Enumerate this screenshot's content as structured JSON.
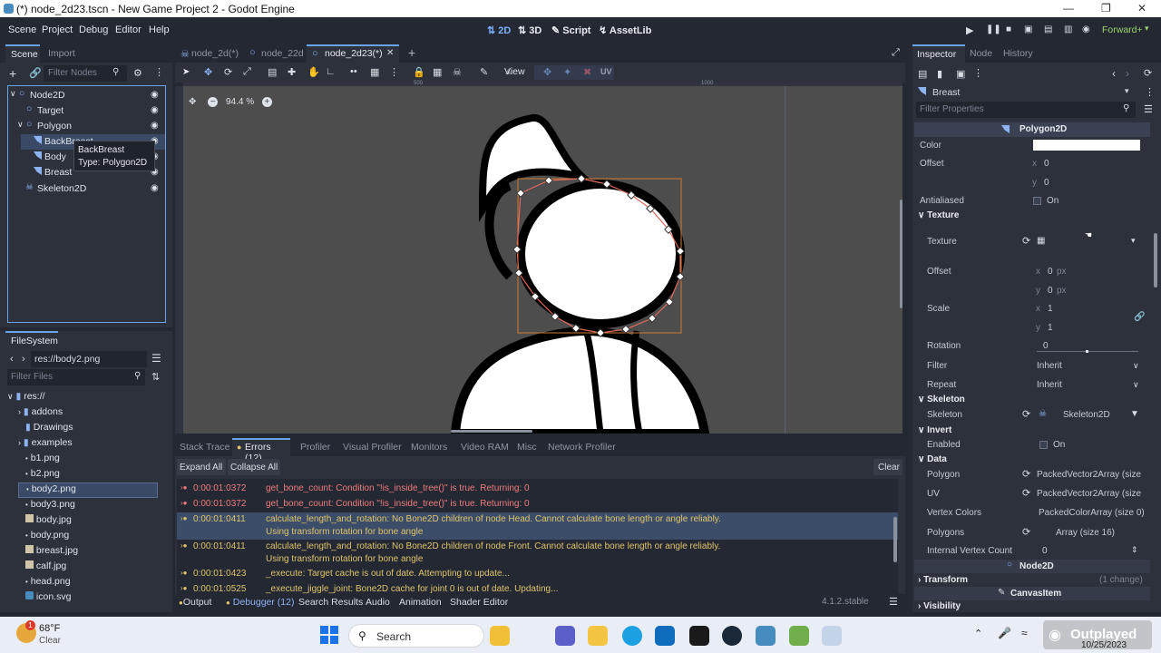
{
  "window": {
    "title": "(*) node_2d23.tscn - New Game Project 2 - Godot Engine"
  },
  "menu": {
    "items": [
      "Scene",
      "Project",
      "Debug",
      "Editor",
      "Help"
    ]
  },
  "workspaces": [
    "2D",
    "3D",
    "Script",
    "AssetLib"
  ],
  "renderer": "Forward+",
  "scene_dock": {
    "tabs": [
      "Scene",
      "Import"
    ],
    "filter_placeholder": "Filter Nodes",
    "tree": [
      {
        "label": "Node2D",
        "depth": 0
      },
      {
        "label": "Target",
        "depth": 1
      },
      {
        "label": "Polygon",
        "depth": 1
      },
      {
        "label": "BackBreast",
        "depth": 2
      },
      {
        "label": "Body",
        "depth": 2
      },
      {
        "label": "Breast",
        "depth": 2
      },
      {
        "label": "Skeleton2D",
        "depth": 1
      }
    ],
    "tooltip_line1": "BackBreast",
    "tooltip_line2": "Type: Polygon2D"
  },
  "filesystem": {
    "title": "FileSystem",
    "path": "res://body2.png",
    "filter_placeholder": "Filter Files",
    "items": [
      "res://",
      "addons",
      "Drawings",
      "examples",
      "b1.png",
      "b2.png",
      "body2.png",
      "body3.png",
      "body.jpg",
      "body.png",
      "breast.jpg",
      "calf.jpg",
      "head.png",
      "icon.svg"
    ]
  },
  "editor_tabs": [
    "node_2d(*)",
    "node_22d",
    "node_2d23(*)"
  ],
  "toolbar": {
    "view_label": "View",
    "uv_label": "UV"
  },
  "viewport": {
    "zoom": "94.4 %",
    "ruler_500": "500",
    "ruler_1000": "1000"
  },
  "bottom_panel": {
    "tabs": [
      "Stack Trace",
      "Errors (12)",
      "Profiler",
      "Visual Profiler",
      "Monitors",
      "Video RAM",
      "Misc",
      "Network Profiler"
    ],
    "expand_all": "Expand All",
    "collapse_all": "Collapse All",
    "clear": "Clear",
    "errors": [
      {
        "time": "0:00:01:0372",
        "msg": "get_bone_count: Condition \"!is_inside_tree()\" is true. Returning: 0",
        "msg2": "",
        "kind": "error"
      },
      {
        "time": "0:00:01:0372",
        "msg": "get_bone_count: Condition \"!is_inside_tree()\" is true. Returning: 0",
        "msg2": "",
        "kind": "error"
      },
      {
        "time": "0:00:01:0411",
        "msg": "calculate_length_and_rotation: No Bone2D children of node Head. Cannot calculate bone length or angle reliably.",
        "msg2": "Using transform rotation for bone angle",
        "kind": "warning"
      },
      {
        "time": "0:00:01:0411",
        "msg": "calculate_length_and_rotation: No Bone2D children of node Front. Cannot calculate bone length or angle reliably.",
        "msg2": "Using transform rotation for bone angle",
        "kind": "warning"
      },
      {
        "time": "0:00:01:0423",
        "msg": "_execute: Target cache is out of date. Attempting to update...",
        "msg2": "",
        "kind": "warning"
      },
      {
        "time": "0:00:01:0525",
        "msg": "_execute_jiggle_joint: Bone2D cache for joint 0 is out of date. Updating...",
        "msg2": "",
        "kind": "warning"
      }
    ]
  },
  "status_bar": {
    "tabs": [
      "Output",
      "Debugger (12)",
      "Search Results",
      "Audio",
      "Animation",
      "Shader Editor"
    ],
    "version": "4.1.2.stable"
  },
  "inspector": {
    "tabs": [
      "Inspector",
      "Node",
      "History"
    ],
    "node_name": "Breast",
    "filter_placeholder": "Filter Properties",
    "class_name": "Polygon2D",
    "props": {
      "color": "Color",
      "offset": "Offset",
      "offset_x": "0",
      "offset_y": "0",
      "antialiased": "Antialiased",
      "on": "On",
      "texture_sec": "Texture",
      "texture": "Texture",
      "t_offset": "Offset",
      "t_offset_x": "0",
      "t_offset_y": "0",
      "px": "px",
      "scale": "Scale",
      "scale_x": "1",
      "scale_y": "1",
      "rotation": "Rotation",
      "rotation_val": "0",
      "filter": "Filter",
      "filter_val": "Inherit",
      "repeat": "Repeat",
      "repeat_val": "Inherit",
      "skeleton_sec": "Skeleton",
      "skeleton": "Skeleton",
      "skeleton_val": "Skeleton2D",
      "invert_sec": "Invert",
      "enabled": "Enabled",
      "enabled_val": "On",
      "data_sec": "Data",
      "polygon": "Polygon",
      "polygon_val": "PackedVector2Array (size",
      "uv": "UV",
      "uv_val": "PackedVector2Array (size",
      "vertex_colors": "Vertex Colors",
      "vertex_colors_val": "PackedColorArray (size 0)",
      "polygons": "Polygons",
      "polygons_val": "Array (size 16)",
      "ivc": "Internal Vertex Count",
      "ivc_val": "0",
      "node2d_sec": "Node2D",
      "transform": "Transform",
      "transform_change": "(1 change)",
      "canvasitem_sec": "CanvasItem",
      "visibility": "Visibility"
    }
  },
  "taskbar": {
    "temp": "68°F",
    "weather": "Clear",
    "badge": "1",
    "search": "Search",
    "date": "10/25/2023",
    "watermark": "Outplayed"
  },
  "colors": {
    "accent": "#6aa3e8",
    "error": "#ef7d7d",
    "warning": "#e0c46a",
    "bg": "#232833",
    "panel": "#2c313c"
  }
}
